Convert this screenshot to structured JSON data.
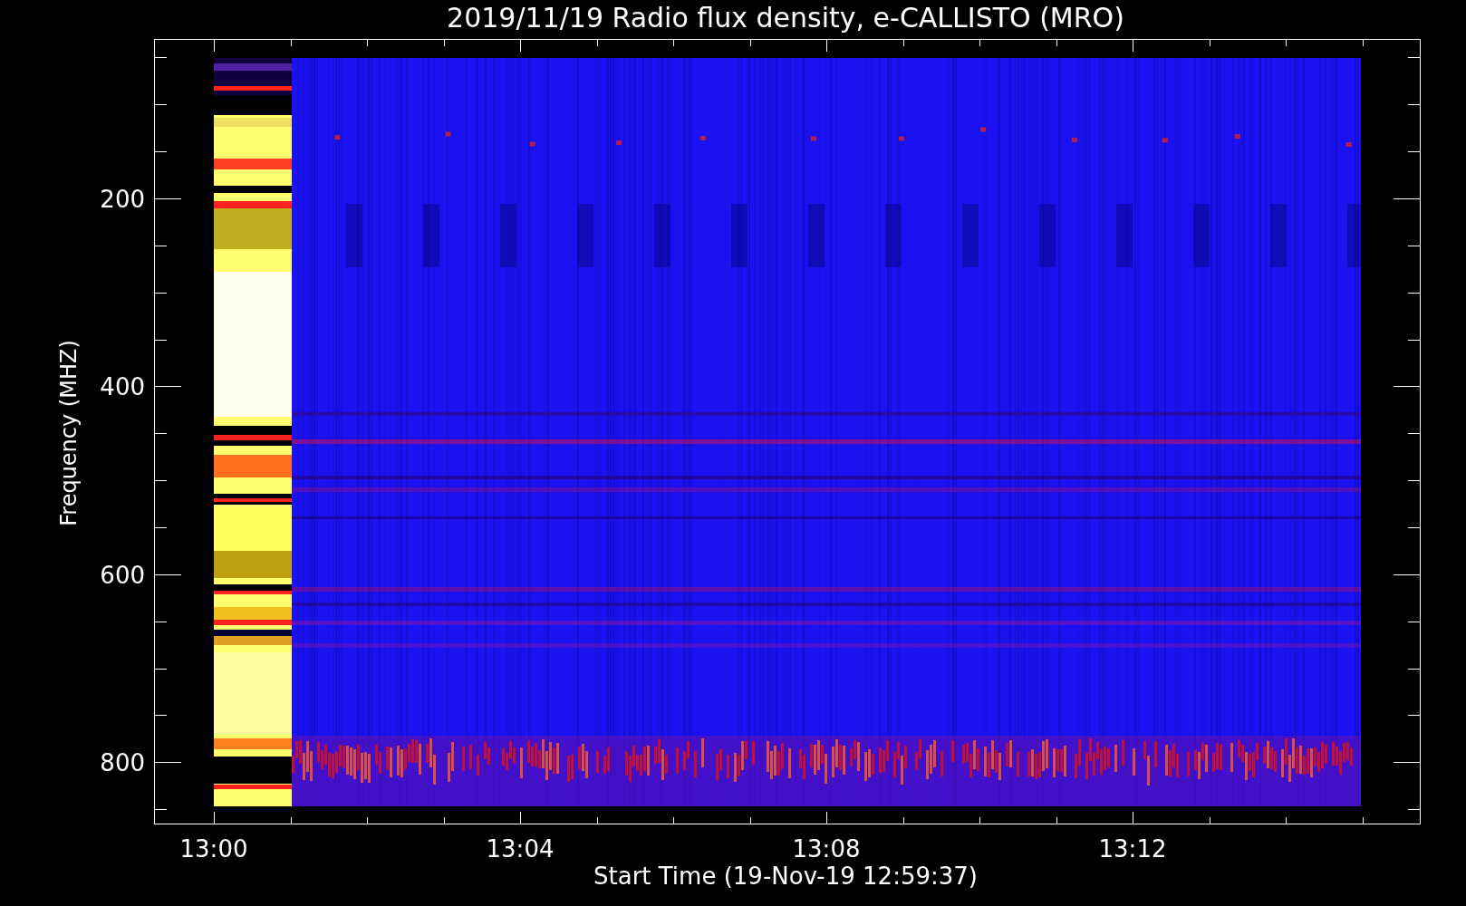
{
  "chart": {
    "title": "2019/11/19  Radio flux density, e-CALLISTO (MRO)",
    "ylabel": "Frequency (MHZ)",
    "xlabel": "Start Time (19-Nov-19 12:59:37)",
    "yticks": [
      "200",
      "400",
      "600",
      "800"
    ],
    "xticks": [
      "13:00",
      "13:04",
      "13:08",
      "13:12"
    ]
  }
}
